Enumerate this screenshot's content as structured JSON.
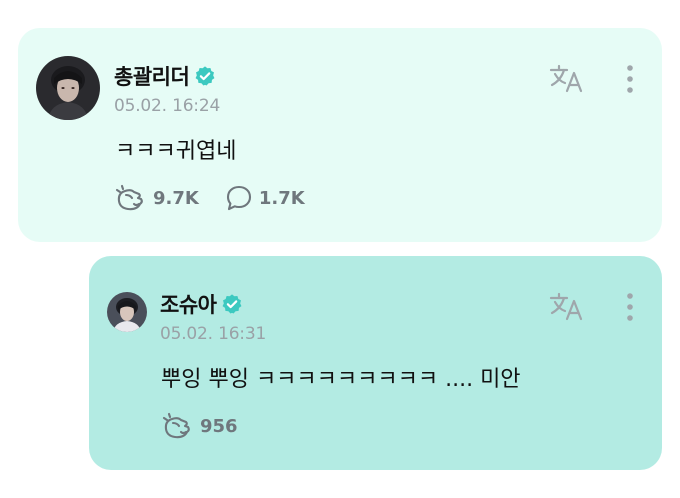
{
  "post": {
    "author": "총괄리더",
    "timestamp": "05.02. 16:24",
    "text": "ㅋㅋㅋ귀엽네",
    "likes": "9.7K",
    "comments": "1.7K"
  },
  "reply": {
    "author": "조슈아",
    "timestamp": "05.02. 16:31",
    "text": "뿌잉 뿌잉 ㅋㅋㅋㅋㅋㅋㅋㅋㅋ .... 미안",
    "likes": "956"
  },
  "colors": {
    "post_background": "#e6fcf6",
    "reply_background": "#b3ebe3",
    "verified_badge": "#3cc9c0",
    "meta_text": "#9aa1a6"
  },
  "icons": {
    "verified": "verified-badge-icon",
    "translate": "translate-icon",
    "more": "more-vertical-icon",
    "like": "cheer-hand-icon",
    "comment": "comment-bubble-icon"
  }
}
